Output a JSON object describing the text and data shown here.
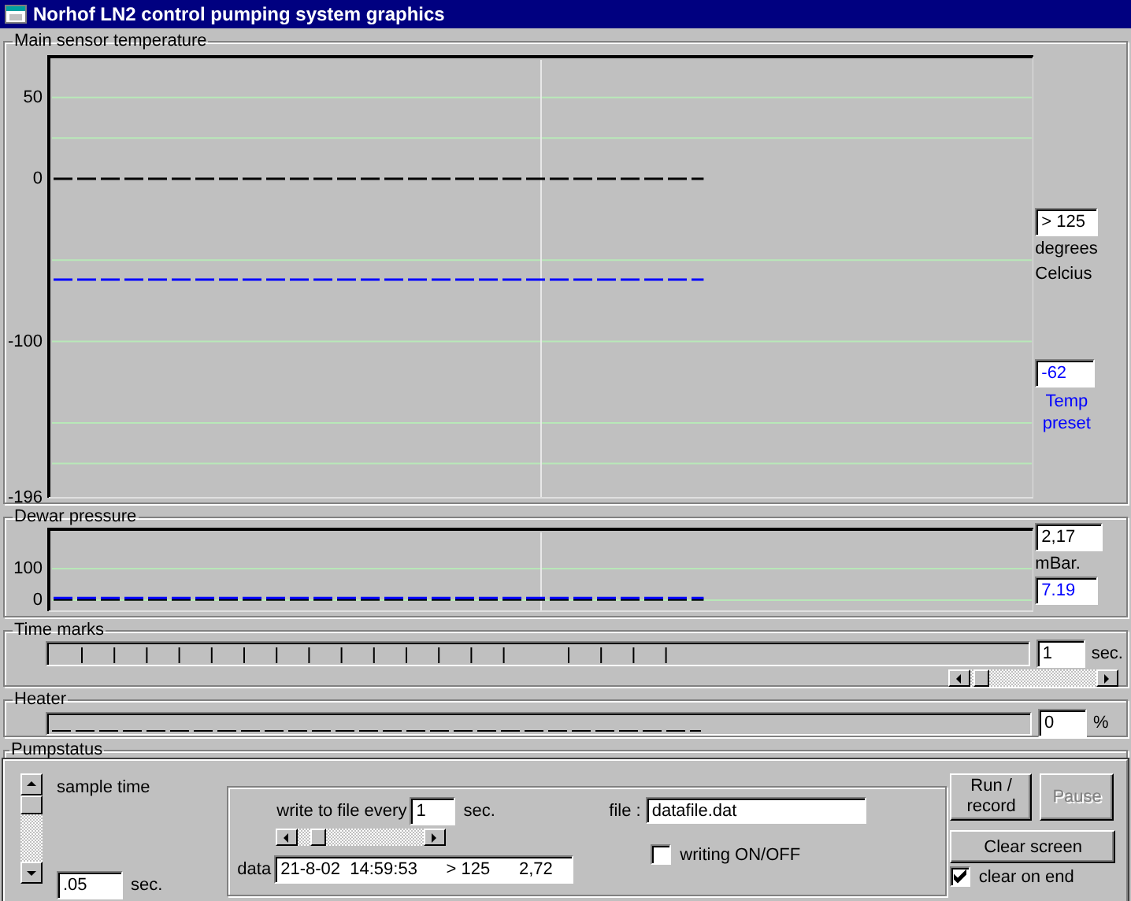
{
  "window": {
    "title": "Norhof LN2 control pumping system graphics"
  },
  "temperature": {
    "label": "Main sensor temperature",
    "reading": "> 125",
    "unit": "degrees Celcius",
    "preset": "-62",
    "preset_label": "Temp preset",
    "chart_data": {
      "type": "line",
      "ylim": [
        -196,
        75
      ],
      "yticks": [
        50,
        0,
        -100,
        -196
      ],
      "categories": [
        null,
        null,
        null,
        null,
        null,
        null,
        null,
        null,
        null,
        null,
        null,
        null,
        null,
        null,
        null,
        null,
        null,
        null,
        null,
        null,
        null,
        null,
        null,
        null,
        null,
        null,
        null,
        null,
        null,
        null,
        null
      ],
      "series": [
        {
          "color": "#000000",
          "line_style": "dashed",
          "values": [
            0,
            0,
            0,
            0,
            0,
            0,
            0,
            0,
            0,
            0,
            0,
            0,
            0,
            0,
            0,
            0,
            0,
            0,
            0,
            0,
            0,
            null,
            null,
            null,
            null,
            null,
            null,
            null,
            null,
            null,
            null
          ]
        },
        {
          "color": "#0000ff",
          "line_style": "dashed",
          "values": [
            -62,
            -62,
            -62,
            -62,
            -62,
            -62,
            -62,
            -62,
            -62,
            -62,
            -62,
            -62,
            -62,
            -62,
            -62,
            -62,
            -62,
            -62,
            -62,
            -62,
            -62,
            null,
            null,
            null,
            null,
            null,
            null,
            null,
            null,
            null,
            null
          ]
        }
      ]
    }
  },
  "pressure": {
    "label": "Dewar pressure",
    "reading": "2,17",
    "unit": "mBar.",
    "preset": "7.19",
    "chart_data": {
      "type": "line",
      "ylim": [
        -35,
        225
      ],
      "yticks": [
        100,
        0
      ],
      "categories": [
        null,
        null,
        null,
        null,
        null,
        null,
        null,
        null,
        null,
        null,
        null,
        null,
        null,
        null,
        null,
        null,
        null,
        null,
        null,
        null,
        null,
        null,
        null,
        null,
        null,
        null,
        null,
        null,
        null,
        null,
        null
      ],
      "series": [
        {
          "color": "#000000",
          "line_style": "dashed",
          "values": [
            2,
            2,
            2,
            2,
            2,
            2,
            2,
            2,
            2,
            2,
            2,
            2,
            2,
            2,
            2,
            2,
            2,
            2,
            2,
            2,
            2,
            null,
            null,
            null,
            null,
            null,
            null,
            null,
            null,
            null,
            null
          ]
        },
        {
          "color": "#0000ff",
          "line_style": "dashed",
          "values": [
            7,
            7,
            7,
            7,
            7,
            7,
            7,
            7,
            7,
            7,
            7,
            7,
            7,
            7,
            7,
            7,
            7,
            7,
            7,
            7,
            7,
            null,
            null,
            null,
            null,
            null,
            null,
            null,
            null,
            null,
            null
          ]
        }
      ]
    }
  },
  "time_marks": {
    "label": "Time marks",
    "value": "1",
    "unit": "sec."
  },
  "heater": {
    "label": "Heater",
    "value": "0",
    "unit": "%"
  },
  "pumpstatus": {
    "label": "Pumpstatus"
  },
  "controls": {
    "sample_time": {
      "label": "sample time",
      "value": ".05",
      "unit": "sec."
    },
    "write_every": {
      "label": "write to file every",
      "value": "1",
      "unit": "sec."
    },
    "data": {
      "label": "data",
      "value": "21-8-02  14:59:53      > 125      2,72"
    },
    "file": {
      "label": "file :",
      "value": "datafile.dat"
    },
    "writing": {
      "label": "writing ON/OFF",
      "checked": false
    },
    "buttons": [
      {
        "label": "Run / record",
        "disabled": false
      },
      {
        "label": "Pause",
        "disabled": true
      }
    ],
    "clear_button": {
      "label": "Clear screen",
      "disabled": false
    },
    "clear_on_end": {
      "label": "clear on end",
      "checked": true
    }
  }
}
